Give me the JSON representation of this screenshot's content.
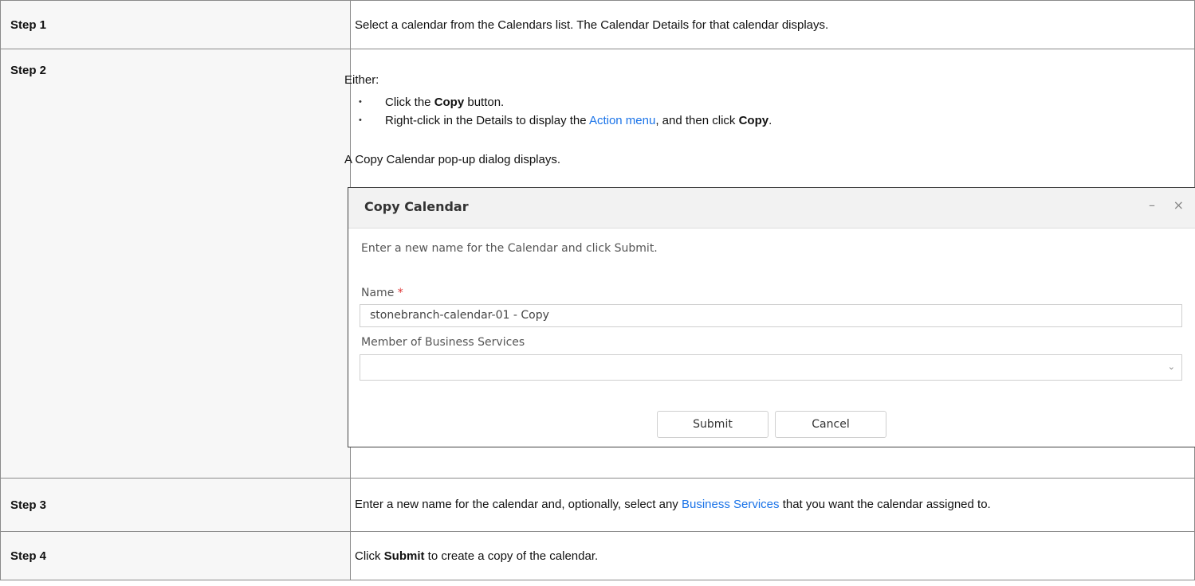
{
  "steps": [
    {
      "label": "Step 1",
      "text": "Select a calendar from the Calendars list. The Calendar Details for that calendar displays."
    },
    {
      "label": "Step 2",
      "intro": "Either:",
      "bullets": [
        {
          "pre": "Click the ",
          "bold": "Copy",
          "post": " button."
        },
        {
          "pre": "Right-click in the Details to display the ",
          "link": "Action menu",
          "mid": ", and then click ",
          "bold": "Copy",
          "post": "."
        }
      ],
      "after": "A Copy Calendar pop-up dialog displays."
    },
    {
      "label": "Step 3",
      "pre": "Enter a new name for the calendar and, optionally, select any ",
      "link": "Business Services",
      "post": " that you want the calendar assigned to."
    },
    {
      "label": "Step 4",
      "pre": "Click ",
      "bold": "Submit",
      "post": " to create a copy of the calendar."
    }
  ],
  "dialog": {
    "title": "Copy Calendar",
    "minimize_icon": "minimize-icon",
    "close_icon": "close-icon",
    "instruction": "Enter a new name for the Calendar and click Submit.",
    "name_label": "Name",
    "required_marker": "*",
    "name_value": "stonebranch-calendar-01 - Copy",
    "business_services_label": "Member of Business Services",
    "business_services_value": "",
    "submit_label": "Submit",
    "cancel_label": "Cancel"
  },
  "colors": {
    "link": "#1a73e8",
    "required": "#dd3333",
    "label_bg": "#f7f7f7"
  }
}
